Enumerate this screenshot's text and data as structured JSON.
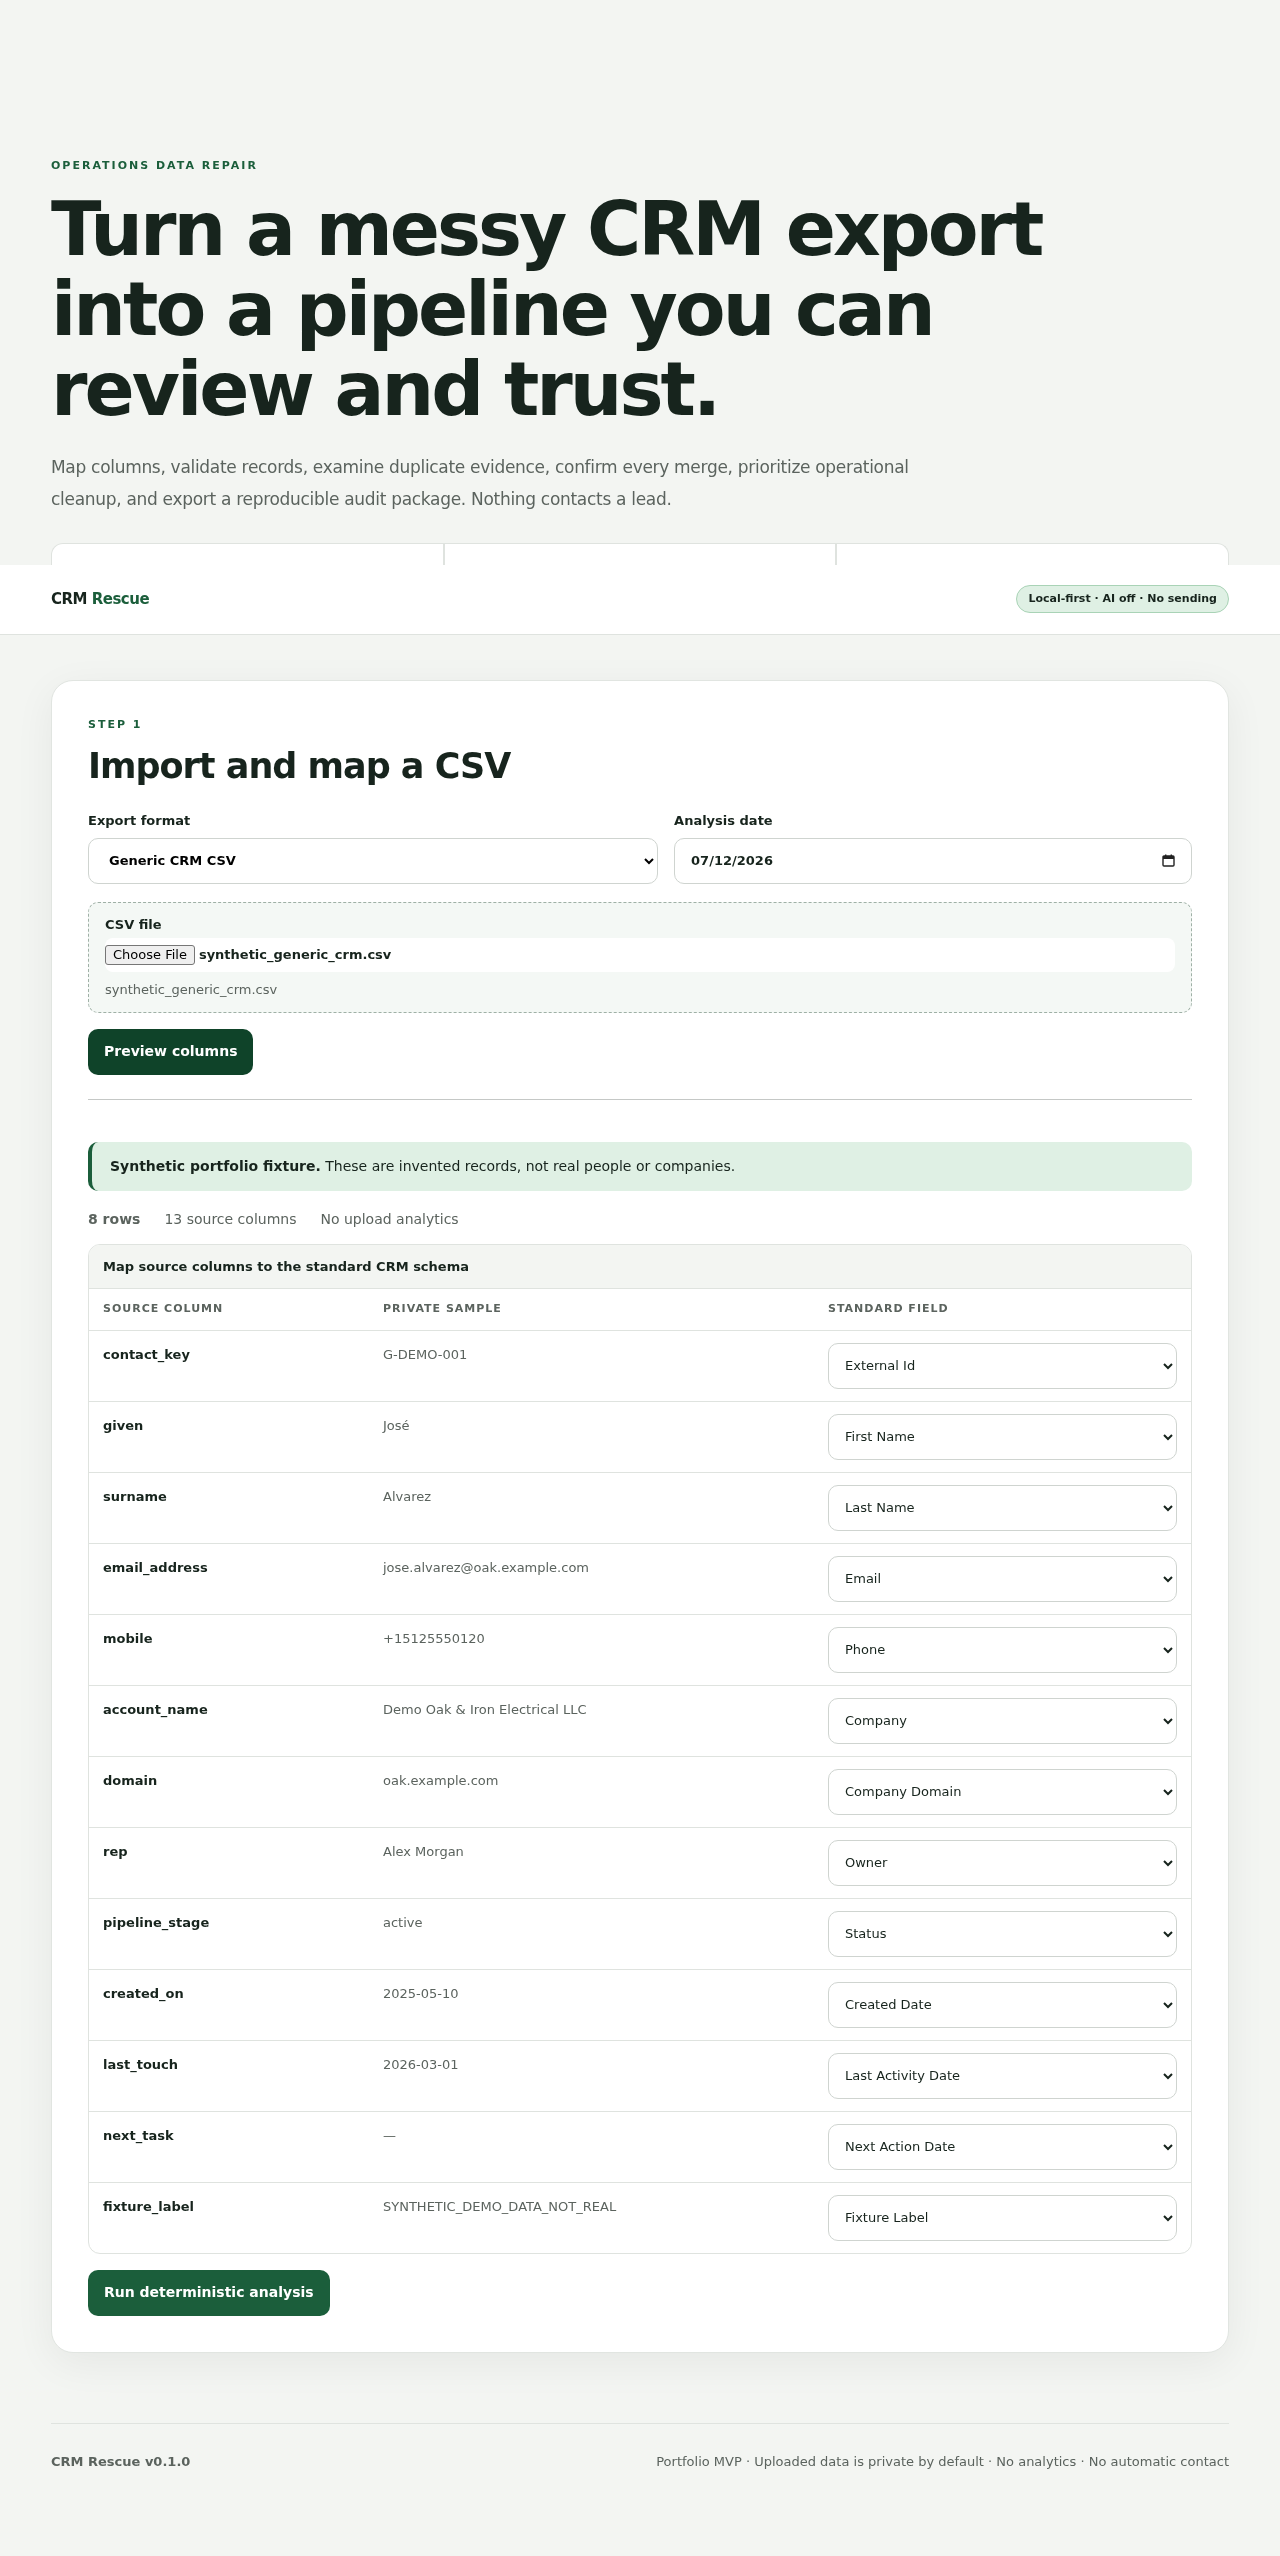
{
  "hero": {
    "eyebrow": "OPERATIONS DATA REPAIR",
    "headline": "Turn a messy CRM export into a pipeline you can review and trust.",
    "lead": "Map columns, validate records, examine duplicate evidence, confirm every merge, prioritize operational cleanup, and export a reproducible audit package. Nothing contacts a lead."
  },
  "navbar": {
    "brand_first": "CRM",
    "brand_second": "Rescue",
    "badge": "Local-first · AI off · No sending"
  },
  "step": {
    "eyebrow": "STEP 1",
    "title": "Import and map a CSV",
    "export_format": {
      "label": "Export format",
      "value": "Generic CRM CSV"
    },
    "analysis_date": {
      "label": "Analysis date",
      "value": "07/12/2026"
    },
    "csv_file": {
      "label": "CSV file",
      "button": "Choose File",
      "file_name": "synthetic_generic_crm.csv",
      "hint": "synthetic_generic_crm.csv"
    },
    "preview_button": "Preview columns",
    "notice": "**Synthetic portfolio fixture.** These are invented records, not real people or companies.",
    "stats": [
      "8 rows",
      "13 source columns",
      "No upload analytics"
    ],
    "table": {
      "title": "Map source columns to the standard CRM schema",
      "columns": [
        "SOURCE COLUMN",
        "PRIVATE SAMPLE",
        "STANDARD FIELD"
      ],
      "rows": [
        {
          "source": "contact_key",
          "sample": "G-DEMO-001",
          "field": "External Id"
        },
        {
          "source": "given",
          "sample": "José",
          "field": "First Name"
        },
        {
          "source": "surname",
          "sample": "Alvarez",
          "field": "Last Name"
        },
        {
          "source": "email_address",
          "sample": "jose.alvarez@oak.example.com",
          "field": "Email"
        },
        {
          "source": "mobile",
          "sample": "+15125550120",
          "field": "Phone"
        },
        {
          "source": "account_name",
          "sample": "Demo Oak & Iron Electrical LLC",
          "field": "Company"
        },
        {
          "source": "domain",
          "sample": "oak.example.com",
          "field": "Company Domain"
        },
        {
          "source": "rep",
          "sample": "Alex Morgan",
          "field": "Owner"
        },
        {
          "source": "pipeline_stage",
          "sample": "active",
          "field": "Status"
        },
        {
          "source": "created_on",
          "sample": "2025-05-10",
          "field": "Created Date"
        },
        {
          "source": "last_touch",
          "sample": "2026-03-01",
          "field": "Last Activity Date"
        },
        {
          "source": "next_task",
          "sample": "—",
          "field": "Next Action Date"
        },
        {
          "source": "fixture_label",
          "sample": "SYNTHETIC_DEMO_DATA_NOT_REAL",
          "field": "Fixture Label"
        }
      ]
    },
    "run_button": "Run deterministic analysis"
  },
  "footer": {
    "version": "CRM Rescue v0.1.0",
    "note": "Portfolio MVP · Uploaded data is private by default · No analytics · No automatic contact"
  }
}
